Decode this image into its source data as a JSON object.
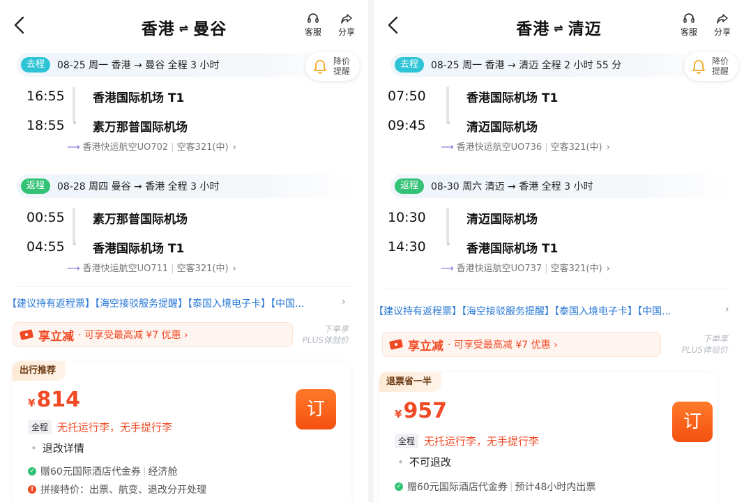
{
  "left": {
    "header": {
      "from": "香港",
      "to": "曼谷",
      "service_label": "客服",
      "share_label": "分享",
      "arrows": "⇌"
    },
    "price_alert": {
      "label": "降价提醒"
    },
    "outbound": {
      "tag": "去程",
      "info": "08-25 周一   香港 → 曼谷   全程 3 小时",
      "dep_time": "16:55",
      "dep_airport": "香港国际机场 T1",
      "arr_time": "18:55",
      "arr_airport": "素万那普国际机场",
      "airline": "香港快运航空UO702",
      "aircraft": "空客321(中)"
    },
    "return": {
      "tag": "返程",
      "info": "08-28 周四   曼谷 → 香港   全程 3 小时",
      "dep_time": "00:55",
      "dep_airport": "素万那普国际机场",
      "arr_time": "04:55",
      "arr_airport": "香港国际机场 T1",
      "airline": "香港快运航空UO711",
      "aircraft": "空客321(中)"
    },
    "tips": "【建议持有返程票】【海空接驳服务提醒】【泰国入境电子卡】【中国...",
    "promo": {
      "main": "享立减",
      "sub": "· 可享受最高减 ¥7 优惠 ›"
    },
    "plus_note": {
      "line1": "下单享",
      "line2": "PLUS体验价"
    },
    "card": {
      "badge": "出行推荐",
      "currency": "¥",
      "price": "814",
      "book_label": "订",
      "luggage_badge": "全程",
      "luggage_text": "无托运行李，无手提行李",
      "refund": "退改详情",
      "perk1_a": "赠60元国际酒店代金券",
      "perk1_b": "经济舱",
      "perk2": "拼接特价：出票、航变、退改分开处理"
    }
  },
  "right": {
    "header": {
      "from": "香港",
      "to": "清迈",
      "service_label": "客服",
      "share_label": "分享",
      "arrows": "⇌"
    },
    "price_alert": {
      "label": "降价提醒"
    },
    "outbound": {
      "tag": "去程",
      "info": "08-25 周一   香港 → 清迈   全程 2 小时 55 分",
      "dep_time": "07:50",
      "dep_airport": "香港国际机场 T1",
      "arr_time": "09:45",
      "arr_airport": "清迈国际机场",
      "airline": "香港快运航空UO736",
      "aircraft": "空客321(中)"
    },
    "return": {
      "tag": "返程",
      "info": "08-30 周六   清迈 → 香港   全程 3 小时",
      "dep_time": "10:30",
      "dep_airport": "清迈国际机场",
      "arr_time": "14:30",
      "arr_airport": "香港国际机场 T1",
      "airline": "香港快运航空UO737",
      "aircraft": "空客321(中)"
    },
    "tips": "【建议持有返程票】【海空接驳服务提醒】【泰国入境电子卡】【中国...",
    "promo": {
      "main": "享立减",
      "sub": "· 可享受最高减 ¥7 优惠 ›"
    },
    "plus_note": {
      "line1": "下单享",
      "line2": "PLUS体验价"
    },
    "card": {
      "badge": "退票省一半",
      "currency": "¥",
      "price": "957",
      "book_label": "订",
      "luggage_badge": "全程",
      "luggage_text": "无托运行李，无手提行李",
      "refund": "不可退改",
      "perk1_a": "赠60元国际酒店代金券",
      "perk1_b": "预计48小时内出票"
    }
  },
  "colors": {
    "accent": "#f04a25",
    "outbound_tag": "#2ec4d6",
    "return_tag": "#33c276",
    "link": "#2878d6"
  }
}
